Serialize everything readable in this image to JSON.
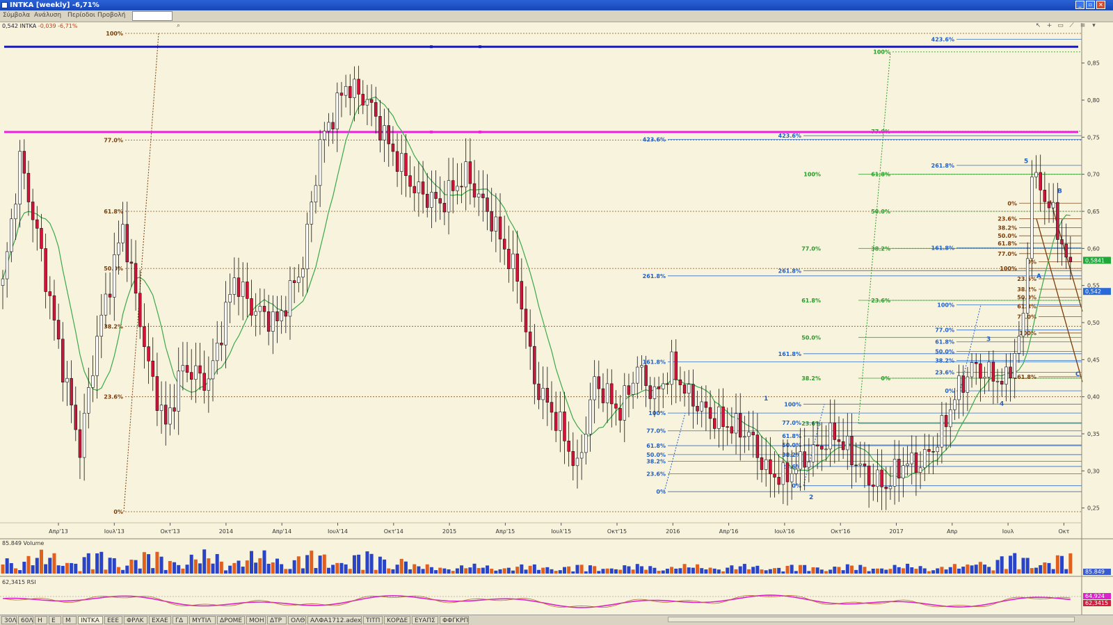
{
  "window": {
    "title": "INTKA [weekly] -6,71%"
  },
  "menu": [
    "Σύμβολα",
    "Ανάλυση",
    "Περίοδοι",
    "Προβολή"
  ],
  "info_line": {
    "price": "0,542",
    "symbol": "INTKA",
    "change": "-0,039 -6,71%"
  },
  "volume_label": "85.849 Volume",
  "rsi_label": "62,3415 RSI",
  "badges": {
    "price": "0,5841",
    "last": "0,542",
    "volume": "85.849",
    "rsi_1": "64,924",
    "rsi_2": "62,3415"
  },
  "bottom_tabs": [
    "30Λ",
    "60Λ",
    "Η",
    "Ε",
    "Μ",
    "ΙΝΤΚΑ",
    "ΕΕΕ",
    "ΦΡΛΚ",
    "ΕΧΑΕ",
    "ΓΔ",
    "ΜΥΤΙΛ",
    "ΔΡΟΜΕ",
    "ΜΟΗ",
    "ΔΤΡ",
    "ΟΛΘ",
    "ΑΛΦΑ1712.adex",
    "ΤΙΤΠ",
    "ΚΟΡΔΕ",
    "ΕΥΑΠΣ",
    "ΦΦΓΚΡΠ"
  ],
  "colors": {
    "up": "#ffffff",
    "down": "#d2143c",
    "ma": "#3aa84a",
    "blue_line": "#1a1ab4",
    "magenta_line": "#ee22dd",
    "fib_brown": "#7a3c0a",
    "fib_blue": "#1f5fc8",
    "fib_green": "#2a9a2a"
  },
  "wave_labels": [
    "1",
    "2",
    "3",
    "4",
    "5",
    "A",
    "B",
    "C"
  ],
  "chart_data": {
    "type": "candlestick",
    "timeframe": "weekly",
    "symbol": "INTKA",
    "y_ticks": [
      "0,85",
      "0,80",
      "0,75",
      "0,70",
      "0,65",
      "0,60",
      "0,55",
      "0,50",
      "0,45",
      "0,40",
      "0,35",
      "0,30",
      "0,25"
    ],
    "ylim": [
      0.23,
      0.89
    ],
    "x_ticks": [
      "Απρ'13",
      "Ιουλ'13",
      "Οκτ'13",
      "2014",
      "Απρ'14",
      "Ιουλ'14",
      "Οκτ'14",
      "2015",
      "Απρ'15",
      "Ιουλ'15",
      "Οκτ'15",
      "2016",
      "Απρ'16",
      "Ιουλ'16",
      "Οκτ'16",
      "2017",
      "Απρ",
      "Ιουλ",
      "Οκτ"
    ],
    "weeks": 230,
    "horizontal_lines": [
      {
        "name": "blue-resistance",
        "value": 0.872
      },
      {
        "name": "magenta-resistance",
        "value": 0.757
      }
    ],
    "fib_main": {
      "levels": [
        {
          "label": "100%",
          "value": 0.89
        },
        {
          "label": "77.0%",
          "value": 0.746
        },
        {
          "label": "61.8%",
          "value": 0.65
        },
        {
          "label": "50.0%",
          "value": 0.573
        },
        {
          "label": "38.2%",
          "value": 0.495
        },
        {
          "label": "23.6%",
          "value": 0.4
        },
        {
          "label": "0%",
          "value": 0.245
        }
      ]
    },
    "fib_green_top": {
      "levels": [
        {
          "label": "100%",
          "value": 0.865
        },
        {
          "label": "77.0%",
          "value": 0.758
        },
        {
          "label": "61.8%",
          "value": 0.7
        },
        {
          "label": "50.0%",
          "value": 0.65
        },
        {
          "label": "38.2%",
          "value": 0.6
        },
        {
          "label": "23.6%",
          "value": 0.53
        },
        {
          "label": "0%",
          "value": 0.425
        }
      ]
    },
    "fib_green_mid": {
      "levels": [
        {
          "label": "100%",
          "value": 0.7
        },
        {
          "label": "77.0%",
          "value": 0.6
        },
        {
          "label": "61.8%",
          "value": 0.53
        },
        {
          "label": "50.0%",
          "value": 0.48
        },
        {
          "label": "38.2%",
          "value": 0.425
        },
        {
          "label": "23.6%",
          "value": 0.364
        }
      ]
    },
    "fib_blue_left": {
      "levels": [
        {
          "label": "423.6%",
          "value": 0.747
        },
        {
          "label": "261.8%",
          "value": 0.563
        },
        {
          "label": "161.8%",
          "value": 0.447
        },
        {
          "label": "100%",
          "value": 0.378
        },
        {
          "label": "77.0%",
          "value": 0.354
        },
        {
          "label": "61.8%",
          "value": 0.334
        },
        {
          "label": "50.0%",
          "value": 0.322
        },
        {
          "label": "38.2%",
          "value": 0.313
        },
        {
          "label": "23.6%",
          "value": 0.296
        },
        {
          "label": "0%",
          "value": 0.272
        }
      ]
    },
    "fib_blue_mid": {
      "levels": [
        {
          "label": "423.6%",
          "value": 0.752
        },
        {
          "label": "261.8%",
          "value": 0.57
        },
        {
          "label": "161.8%",
          "value": 0.458
        },
        {
          "label": "100%",
          "value": 0.39
        },
        {
          "label": "77.0%",
          "value": 0.365
        },
        {
          "label": "61.8%",
          "value": 0.347
        },
        {
          "label": "50.0%",
          "value": 0.335
        },
        {
          "label": "38.2%",
          "value": 0.322
        },
        {
          "label": "23.6%",
          "value": 0.306
        },
        {
          "label": "0%",
          "value": 0.28
        }
      ]
    },
    "fib_blue_right": {
      "levels": [
        {
          "label": "423.6%",
          "value": 0.882
        },
        {
          "label": "261.8%",
          "value": 0.712
        },
        {
          "label": "161.8%",
          "value": 0.601
        },
        {
          "label": "100%",
          "value": 0.524
        },
        {
          "label": "77.0%",
          "value": 0.49
        },
        {
          "label": "61.8%",
          "value": 0.474
        },
        {
          "label": "50.0%",
          "value": 0.461
        },
        {
          "label": "38.2%",
          "value": 0.449
        },
        {
          "label": "23.6%",
          "value": 0.433
        },
        {
          "label": "0%",
          "value": 0.408
        }
      ]
    },
    "fib_brown_top": {
      "levels": [
        {
          "label": "0%",
          "value": 0.661
        },
        {
          "label": "23.6%",
          "value": 0.64
        },
        {
          "label": "38.2%",
          "value": 0.628
        },
        {
          "label": "50.0%",
          "value": 0.617
        },
        {
          "label": "61.8%",
          "value": 0.607
        },
        {
          "label": "77.0%",
          "value": 0.593
        },
        {
          "label": "100%",
          "value": 0.573
        }
      ]
    },
    "fib_brown_mid": {
      "levels": [
        {
          "label": "0%",
          "value": 0.582
        },
        {
          "label": "23.6%",
          "value": 0.559
        },
        {
          "label": "38.2%",
          "value": 0.545
        },
        {
          "label": "50.0%",
          "value": 0.534
        },
        {
          "label": "61.8%",
          "value": 0.522
        },
        {
          "label": "77.0%",
          "value": 0.508
        },
        {
          "label": "100%",
          "value": 0.486
        },
        {
          "label": "161.8%",
          "value": 0.427
        }
      ]
    },
    "fib_brown_low": {
      "levels": [
        {
          "label": "161.8%",
          "value": 0.52
        },
        {
          "label": "261.8%",
          "value": 0.431
        },
        {
          "label": "261.8%",
          "value": 0.35
        },
        {
          "label": "423.6%",
          "value": 0.304
        }
      ]
    }
  }
}
